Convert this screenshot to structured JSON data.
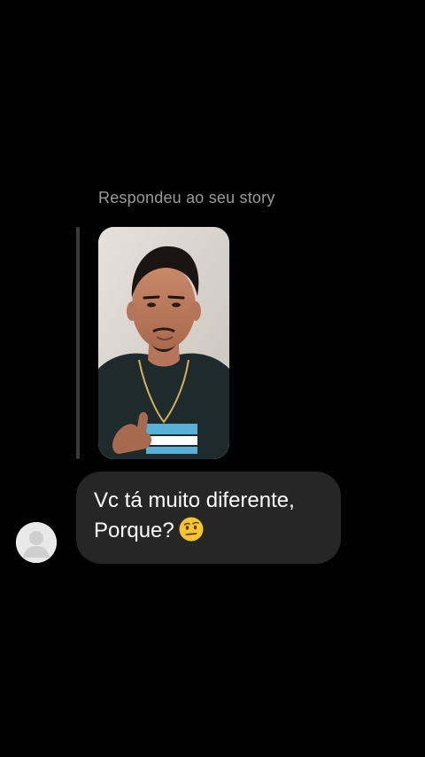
{
  "thread": {
    "reply_caption": "Respondeu ao seu story",
    "story_thumbnail_icon": "person-photo",
    "sender_avatar_icon": "default-avatar-icon",
    "message": {
      "line1": "Vc tá muito diferente,",
      "line2": "Porque?",
      "emoji_icon": "face-with-raised-eyebrow-icon"
    }
  },
  "colors": {
    "background": "#000000",
    "caption": "#9a9a9a",
    "bubble": "#262626",
    "reply_line": "#3a3a3a",
    "text": "#ffffff"
  }
}
